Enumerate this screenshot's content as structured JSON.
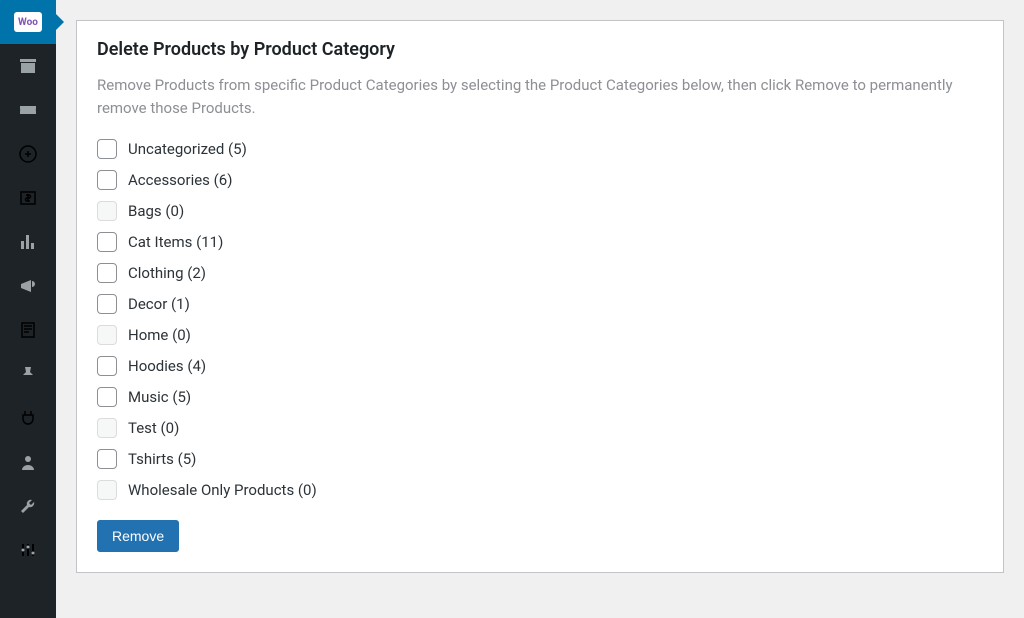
{
  "sidebar": {
    "items": [
      {
        "name": "woocommerce",
        "active": true
      },
      {
        "name": "archive"
      },
      {
        "name": "ticket"
      },
      {
        "name": "catalog"
      },
      {
        "name": "pricing"
      },
      {
        "name": "analytics"
      },
      {
        "name": "marketing"
      },
      {
        "name": "forms"
      },
      {
        "name": "pin"
      },
      {
        "name": "plugins"
      },
      {
        "name": "users"
      },
      {
        "name": "tools"
      },
      {
        "name": "settings"
      }
    ],
    "woo_label": "Woo"
  },
  "panel": {
    "title": "Delete Products by Product Category",
    "description": "Remove Products from specific Product Categories by selecting the Product Categories below, then click Remove to permanently remove those Products.",
    "remove_label": "Remove"
  },
  "categories": [
    {
      "label": "Uncategorized (5)",
      "enabled": true
    },
    {
      "label": "Accessories (6)",
      "enabled": true
    },
    {
      "label": "Bags (0)",
      "enabled": false
    },
    {
      "label": "Cat Items (11)",
      "enabled": true
    },
    {
      "label": "Clothing (2)",
      "enabled": true
    },
    {
      "label": "Decor (1)",
      "enabled": true
    },
    {
      "label": "Home (0)",
      "enabled": false
    },
    {
      "label": "Hoodies (4)",
      "enabled": true
    },
    {
      "label": "Music (5)",
      "enabled": true
    },
    {
      "label": "Test (0)",
      "enabled": false
    },
    {
      "label": "Tshirts (5)",
      "enabled": true
    },
    {
      "label": "Wholesale Only Products (0)",
      "enabled": false
    }
  ]
}
